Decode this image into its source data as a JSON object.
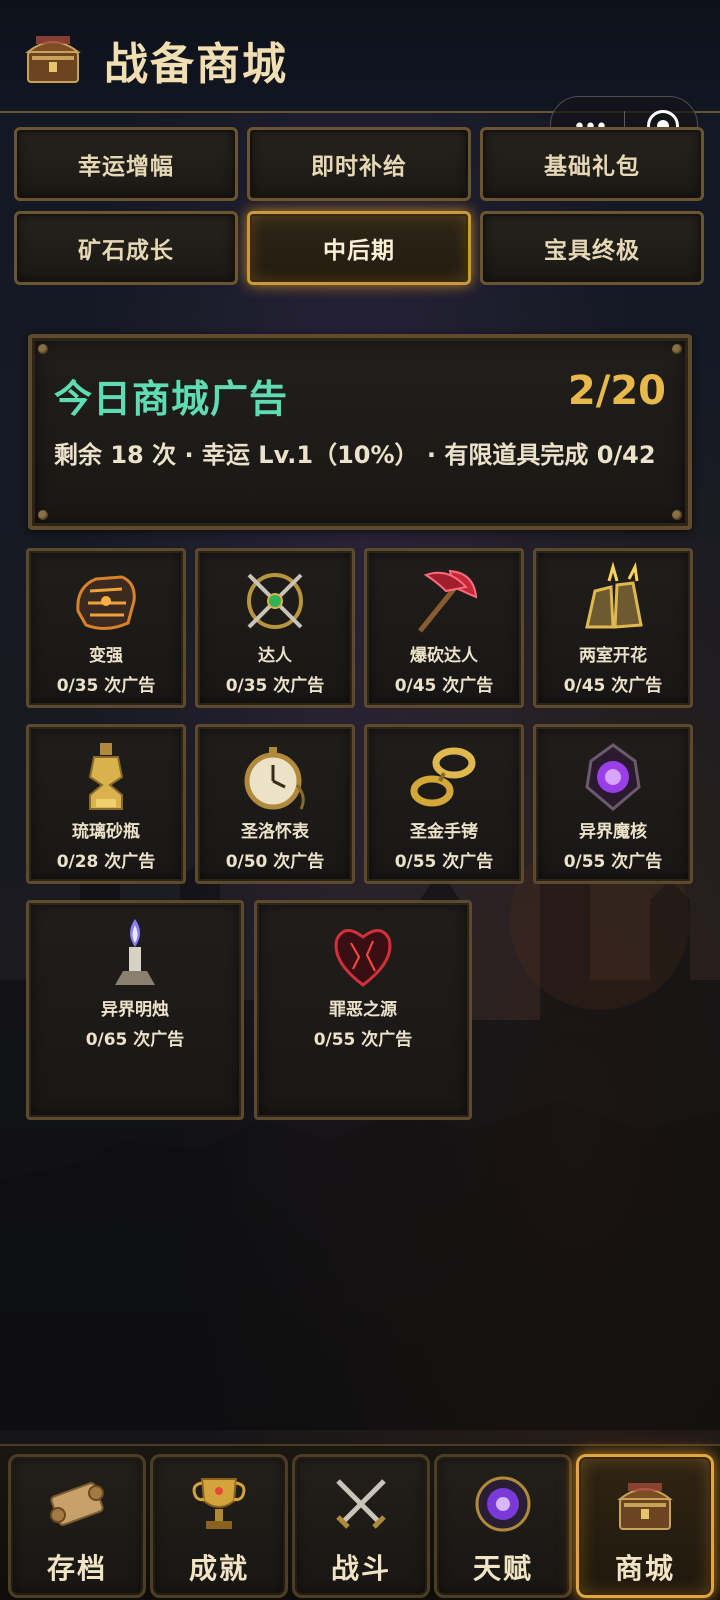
{
  "header": {
    "title": "战备商城",
    "icon": "shop-chest-icon"
  },
  "capsule": {
    "menu_icon": "more-dots-icon",
    "close_icon": "target-circle-icon",
    "dots": "•••"
  },
  "tabs": [
    {
      "label": "幸运增幅",
      "active": false
    },
    {
      "label": "即时补给",
      "active": false
    },
    {
      "label": "基础礼包",
      "active": false
    },
    {
      "label": "矿石成长",
      "active": false
    },
    {
      "label": "中后期",
      "active": true
    },
    {
      "label": "宝具终极",
      "active": false
    }
  ],
  "ad_panel": {
    "title": "今日商城广告",
    "count": "2/20",
    "info": "剩余 18 次 · 幸运 Lv.1（10%） · 有限道具完成 0/42"
  },
  "items": [
    {
      "name": "变强",
      "progress": "0/35 次广告",
      "icon": "gauntlet-icon"
    },
    {
      "name": "达人",
      "progress": "0/35 次广告",
      "icon": "crossed-swords-emblem-icon"
    },
    {
      "name": "爆砍达人",
      "progress": "0/45 次广告",
      "icon": "battle-axe-icon"
    },
    {
      "name": "两室开花",
      "progress": "0/45 次广告",
      "icon": "golden-gauntlets-icon"
    },
    {
      "name": "琉璃砂瓶",
      "progress": "0/28 次广告",
      "icon": "hourglass-bottle-icon"
    },
    {
      "name": "圣洛怀表",
      "progress": "0/50 次广告",
      "icon": "pocket-watch-icon"
    },
    {
      "name": "圣金手铐",
      "progress": "0/55 次广告",
      "icon": "golden-shackles-icon"
    },
    {
      "name": "异界魔核",
      "progress": "0/55 次广告",
      "icon": "void-core-icon"
    },
    {
      "name": "异界明烛",
      "progress": "0/65 次广告",
      "icon": "void-candle-icon"
    },
    {
      "name": "罪恶之源",
      "progress": "0/55 次广告",
      "icon": "sin-heart-icon"
    }
  ],
  "bottom_nav": [
    {
      "label": "存档",
      "icon": "scroll-icon",
      "active": false
    },
    {
      "label": "成就",
      "icon": "trophy-icon",
      "active": false
    },
    {
      "label": "战斗",
      "icon": "crossed-swords-icon",
      "active": false
    },
    {
      "label": "天赋",
      "icon": "talent-orb-icon",
      "active": false
    },
    {
      "label": "商城",
      "icon": "shop-chest-icon",
      "active": true
    }
  ],
  "colors": {
    "accent_gold": "#e8b84d",
    "ad_title_green": "#5fdcb4",
    "active_glow": "#f0a028"
  }
}
